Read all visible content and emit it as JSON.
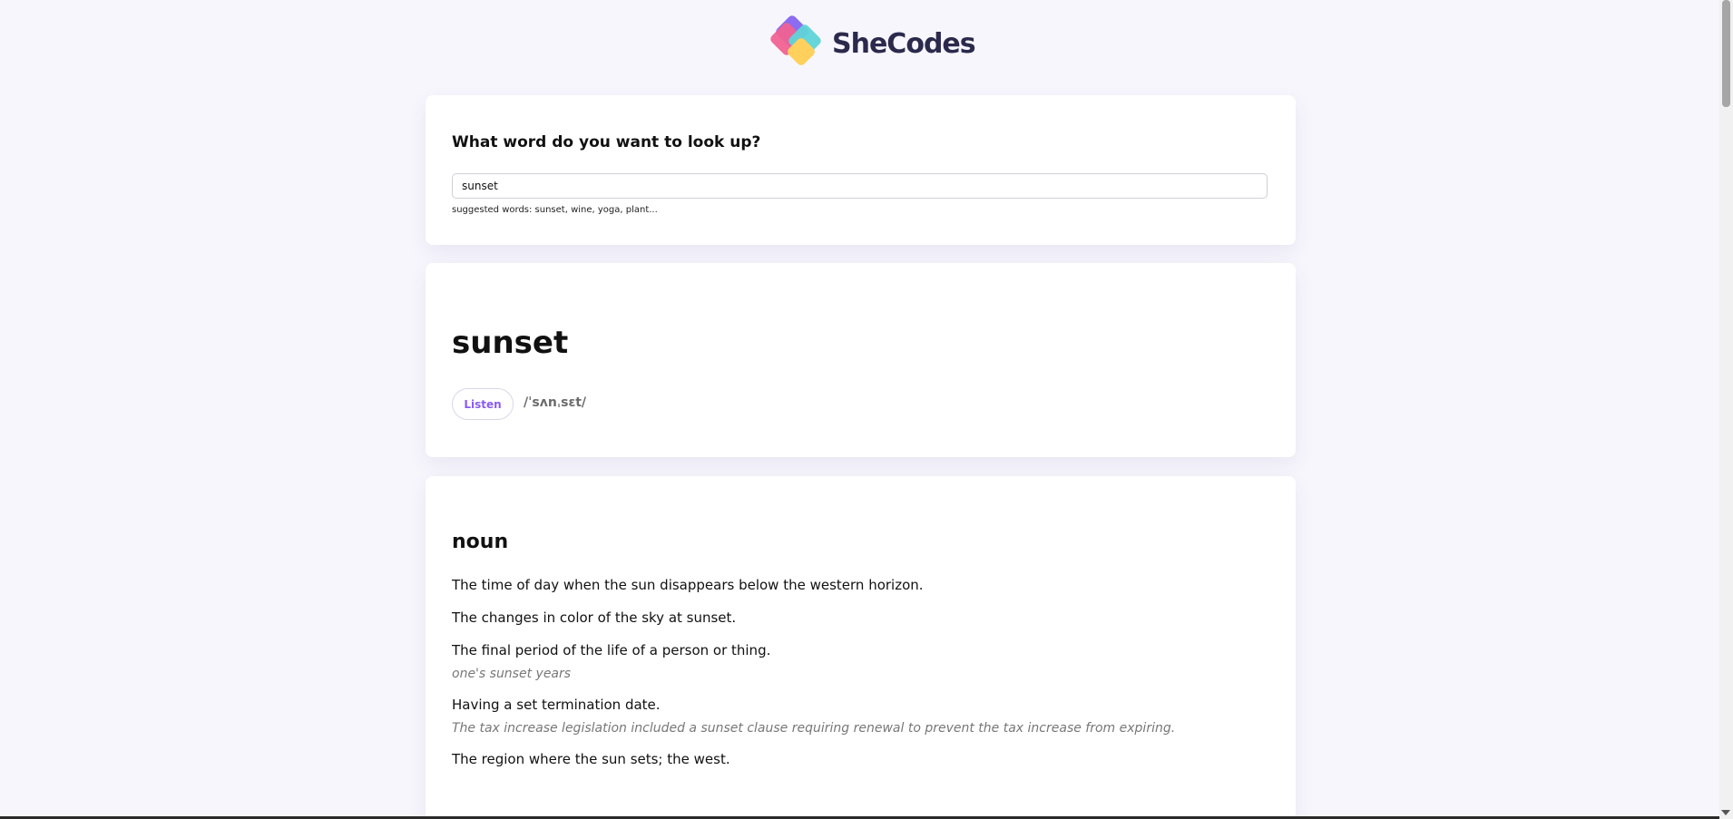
{
  "brand": {
    "name": "SheCodes",
    "colors": {
      "purple": "#8c6cf0",
      "pink": "#f06292",
      "teal": "#5fd4d8",
      "yellow": "#ffd15c",
      "text": "#2b2a4c"
    }
  },
  "search": {
    "title": "What word do you want to look up?",
    "value": "sunset",
    "hint": "suggested words: sunset, wine, yoga, plant..."
  },
  "word_card": {
    "word": "sunset",
    "listen_label": "Listen",
    "phonetic": "/ˈsʌnˌsɛt/",
    "accent_color": "#8a5cf5"
  },
  "meaning": {
    "part_of_speech": "noun",
    "definitions": [
      {
        "text": "The time of day when the sun disappears below the western horizon.",
        "example": ""
      },
      {
        "text": "The changes in color of the sky at sunset.",
        "example": ""
      },
      {
        "text": "The final period of the life of a person or thing.",
        "example": "one's sunset years"
      },
      {
        "text": "Having a set termination date.",
        "example": "The tax increase legislation included a sunset clause requiring renewal to prevent the tax increase from expiring."
      },
      {
        "text": "The region where the sun sets; the west.",
        "example": ""
      }
    ]
  }
}
